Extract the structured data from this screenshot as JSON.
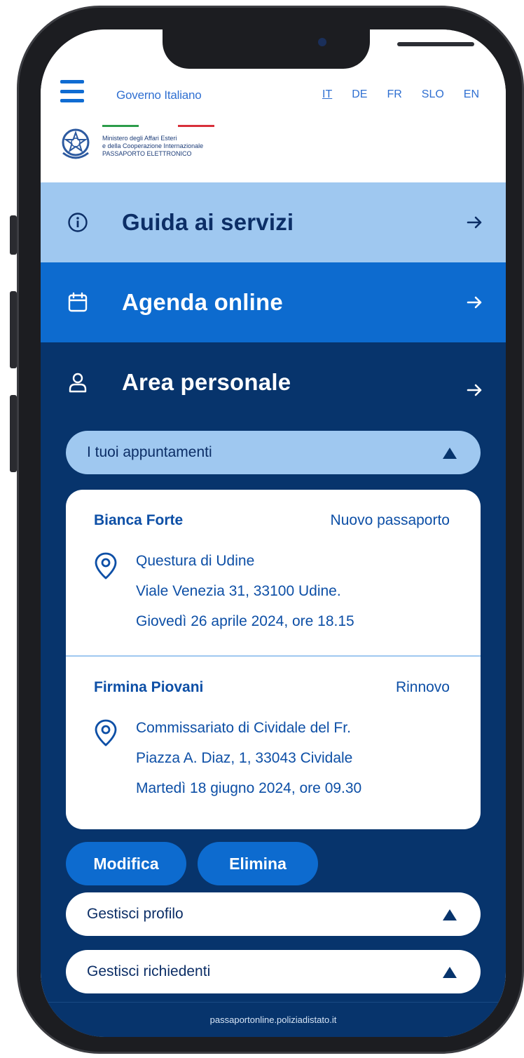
{
  "header": {
    "gov_label": "Governo Italiano",
    "languages": [
      "IT",
      "DE",
      "FR",
      "SLO",
      "EN"
    ],
    "ministry_lines": [
      "Ministero degli Affari Esteri",
      "e della Cooperazione Internazionale",
      "PASSAPORTO ELETTRONICO"
    ]
  },
  "menu": {
    "guide": "Guida ai servizi",
    "agenda": "Agenda online",
    "personal": "Area personale"
  },
  "appointments": {
    "section_label": "I tuoi appuntamenti",
    "items": [
      {
        "name": "Bianca Forte",
        "type": "Nuovo passaporto",
        "office": "Questura di Udine",
        "address": "Viale Venezia 31, 33100 Udine.",
        "datetime": "Giovedì 26 aprile 2024, ore 18.15"
      },
      {
        "name": "Firmina Piovani",
        "type": "Rinnovo",
        "office": "Commissariato di Cividale del Fr.",
        "address": "Piazza A. Diaz, 1, 33043 Cividale",
        "datetime": "Martedì 18 giugno 2024, ore 09.30"
      }
    ],
    "edit_label": "Modifica",
    "delete_label": "Elimina"
  },
  "sections": {
    "profile": "Gestisci profilo",
    "applicants": "Gestisci richiedenti"
  },
  "footer": {
    "url": "passaportonline.poliziadistato.it"
  },
  "colors": {
    "light_band": "#9fc8f0",
    "mid_band": "#0d6bcf",
    "dark_band": "#07346c",
    "text_blue": "#0d4fa6"
  }
}
